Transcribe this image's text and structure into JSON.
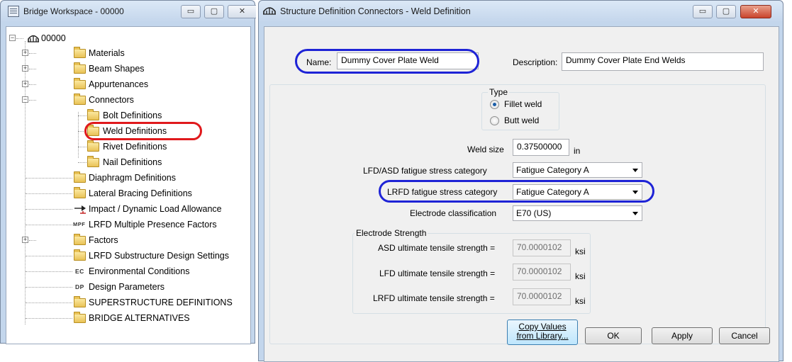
{
  "workspace": {
    "title": "Bridge Workspace - 00000",
    "caption_buttons": {
      "minimize": "▭",
      "maximize": "▢",
      "close": "✕"
    },
    "tree": {
      "root": "00000",
      "items": [
        {
          "label": "Materials",
          "icon": "folder-icon",
          "expandable": true
        },
        {
          "label": "Beam Shapes",
          "icon": "folder-icon",
          "expandable": true
        },
        {
          "label": "Appurtenances",
          "icon": "folder-icon",
          "expandable": true
        },
        {
          "label": "Connectors",
          "icon": "folder-icon",
          "expandable": true,
          "expanded": true
        },
        {
          "label": "Bolt Definitions",
          "icon": "folder-icon"
        },
        {
          "label": "Weld Definitions",
          "icon": "folder-icon",
          "highlighted": true
        },
        {
          "label": "Rivet Definitions",
          "icon": "folder-icon"
        },
        {
          "label": "Nail Definitions",
          "icon": "folder-icon"
        },
        {
          "label": "Diaphragm Definitions",
          "icon": "folder-icon"
        },
        {
          "label": "Lateral Bracing Definitions",
          "icon": "folder-icon"
        },
        {
          "label": "Impact / Dynamic Load Allowance",
          "icon": "impact-arrow-icon"
        },
        {
          "label": "LRFD Multiple Presence Factors",
          "icon": "mpf-icon",
          "icon_text": "MPF"
        },
        {
          "label": "Factors",
          "icon": "folder-icon",
          "expandable": true
        },
        {
          "label": "LRFD Substructure Design Settings",
          "icon": "folder-icon"
        },
        {
          "label": "Environmental Conditions",
          "icon": "ec-icon",
          "icon_text": "EC"
        },
        {
          "label": "Design Parameters",
          "icon": "dp-icon",
          "icon_text": "DP"
        },
        {
          "label": "SUPERSTRUCTURE DEFINITIONS",
          "icon": "folder-icon"
        },
        {
          "label": "BRIDGE ALTERNATIVES",
          "icon": "folder-icon"
        }
      ]
    }
  },
  "dialog": {
    "title": "Structure Definition Connectors - Weld Definition",
    "caption_buttons": {
      "minimize": "▭",
      "maximize": "▢",
      "close": "✕"
    },
    "name_label": "Name:",
    "name_value": "Dummy Cover Plate Weld",
    "description_label": "Description:",
    "description_value": "Dummy Cover Plate End Welds",
    "type": {
      "caption": "Type",
      "options": [
        "Fillet weld",
        "Butt weld"
      ],
      "selected": "Fillet weld"
    },
    "weld_size_label": "Weld size",
    "weld_size_value": "0.37500000",
    "weld_size_unit": "in",
    "lfd_asd_label": "LFD/ASD fatigue stress category",
    "lfd_asd_value": "Fatigue Category A",
    "lrfd_label": "LRFD fatigue stress category",
    "lrfd_value": "Fatigue Category A",
    "electrode_label": "Electrode classification",
    "electrode_value": "E70 (US)",
    "strength": {
      "caption": "Electrode Strength",
      "asd_label": "ASD ultimate tensile strength =",
      "asd_value": "70.0000102",
      "lfd_label": "LFD ultimate tensile strength =",
      "lfd_value": "70.0000102",
      "lrfd_label": "LRFD ultimate tensile strength =",
      "lrfd_value": "70.0000102",
      "unit": "ksi"
    },
    "buttons": {
      "copy_line1": "Copy Values",
      "copy_line2": "from Library...",
      "ok": "OK",
      "apply": "Apply",
      "cancel": "Cancel"
    }
  },
  "colors": {
    "callout_blue": "#1e23d6",
    "callout_red": "#e0191c",
    "window_frame": "#c3d6ec"
  }
}
